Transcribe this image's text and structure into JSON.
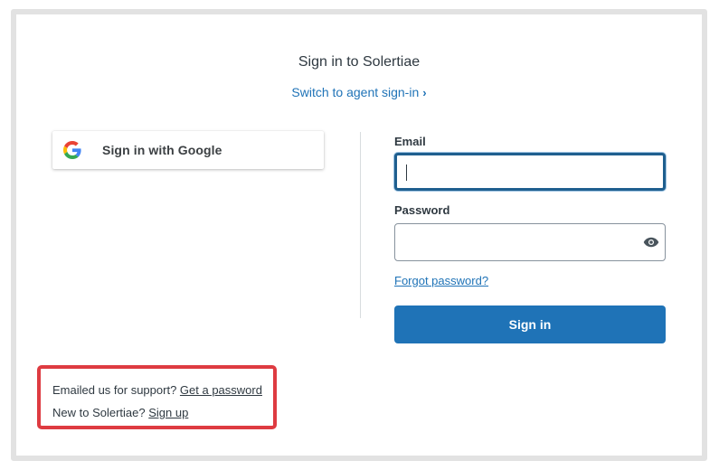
{
  "header": {
    "title": "Sign in to Solertiae",
    "switch_link": "Switch to agent sign-in"
  },
  "google": {
    "label": "Sign in with Google",
    "icon": "google-g-icon"
  },
  "form": {
    "email_label": "Email",
    "email_value": "",
    "password_label": "Password",
    "password_value": "",
    "forgot_link": "Forgot password?",
    "submit_label": "Sign in",
    "show_password_icon": "eye-icon"
  },
  "support": {
    "emailed_text": "Emailed us for support?",
    "get_password_link": "Get a password",
    "new_text": "New to Solertiae?",
    "sign_up_link": "Sign up"
  },
  "colors": {
    "primary": "#1f73b7",
    "highlight_border": "#de3b41",
    "frame_border": "#e2e2e2"
  }
}
